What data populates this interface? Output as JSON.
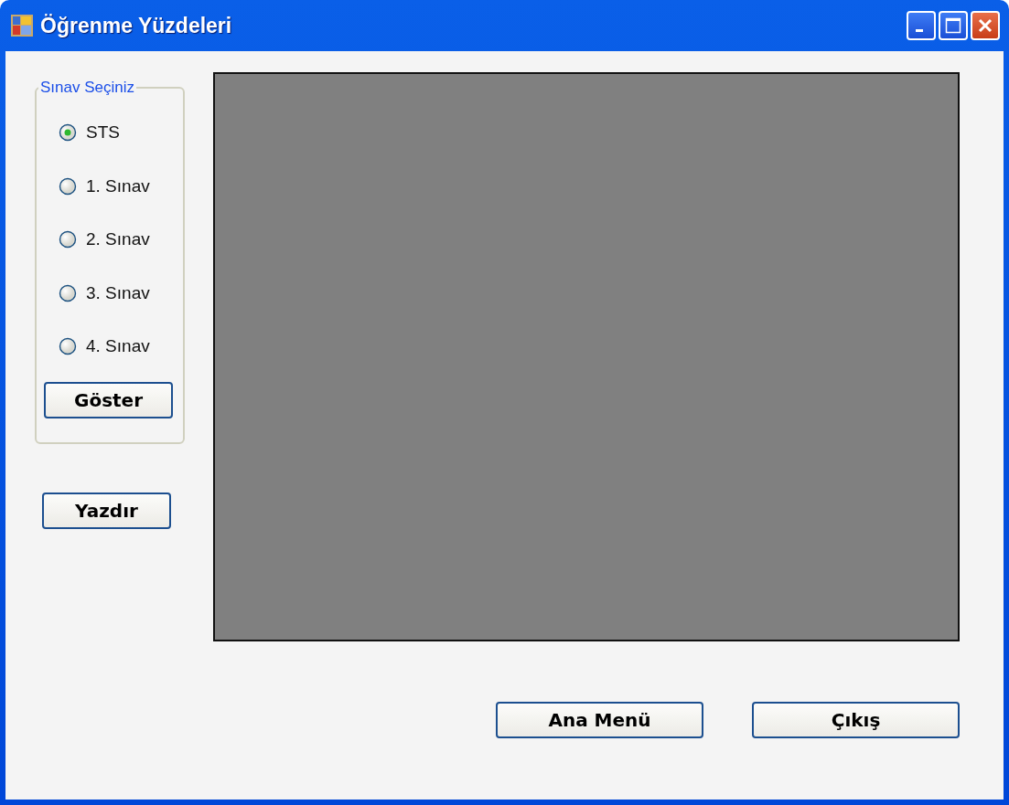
{
  "window": {
    "title": "Öğrenme Yüzdeleri"
  },
  "exam_group": {
    "title": "Sınav Seçiniz",
    "options": [
      {
        "label": "STS",
        "selected": true
      },
      {
        "label": "1. Sınav",
        "selected": false
      },
      {
        "label": "2. Sınav",
        "selected": false
      },
      {
        "label": "3. Sınav",
        "selected": false
      },
      {
        "label": "4. Sınav",
        "selected": false
      }
    ],
    "button": "Göster"
  },
  "print_button": "Yazdır",
  "buttons": [
    "Ana Menü",
    "Çıkış"
  ]
}
